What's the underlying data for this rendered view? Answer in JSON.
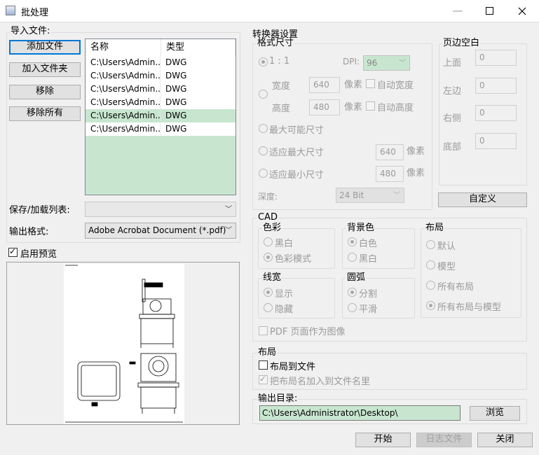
{
  "window": {
    "title": "批处理",
    "min": "—",
    "max": "☐",
    "close": "✕"
  },
  "import": {
    "group_label": "导入文件:",
    "add_file": "添加文件",
    "add_folder": "加入文件夹",
    "remove": "移除",
    "remove_all": "移除所有",
    "columns": [
      "名称",
      "类型"
    ],
    "rows": [
      {
        "name": "C:\\Users\\Admin...",
        "type": "DWG"
      },
      {
        "name": "C:\\Users\\Admin...",
        "type": "DWG"
      },
      {
        "name": "C:\\Users\\Admin...",
        "type": "DWG"
      },
      {
        "name": "C:\\Users\\Admin...",
        "type": "DWG"
      },
      {
        "name": "C:\\Users\\Admin...",
        "type": "DWG"
      },
      {
        "name": "C:\\Users\\Admin...",
        "type": "DWG"
      }
    ],
    "save_load_label": "保存/加载列表:",
    "save_load_value": "",
    "output_format_label": "输出格式:",
    "output_format_value": "Adobe Acrobat Document (*.pdf)",
    "enable_preview": "启用预览"
  },
  "converter": {
    "title": "转换器设置",
    "format_size": {
      "label": "格式尺寸",
      "ratio": "1 : 1",
      "dpi_label": "DPI:",
      "dpi_value": "96",
      "width_label": "宽度",
      "width_value": "640",
      "height_label": "高度",
      "height_value": "480",
      "px": "像素",
      "auto_width": "自动宽度",
      "auto_height": "自动高度",
      "max_size": "最大可能尺寸",
      "fit_max": "适应最大尺寸",
      "fit_max_value": "640",
      "fit_min": "适应最小尺寸",
      "fit_min_value": "480",
      "depth_label": "深度:",
      "depth_value": "24 Bit"
    },
    "margins": {
      "label": "页边空白",
      "top": "上面",
      "top_value": "0",
      "left": "左边",
      "left_value": "0",
      "right": "右侧",
      "right_value": "0",
      "bottom": "底部",
      "bottom_value": "0",
      "custom": "自定义"
    },
    "cad": {
      "label": "CAD",
      "color_label": "色彩",
      "bw": "黑白",
      "color_mode": "色彩模式",
      "bg_label": "背景色",
      "white": "白色",
      "black": "黑白",
      "layout_label": "布局",
      "default": "默认",
      "model": "模型",
      "all_layouts": "所有布局",
      "all_layouts_model": "所有布局与模型",
      "lw_label": "线宽",
      "show": "显示",
      "hide": "隐藏",
      "arc_label": "圆弧",
      "split": "分割",
      "smooth": "平滑",
      "pdf_as_image": "PDF 页面作为图像"
    },
    "layout": {
      "label": "布局",
      "layout_to_file": "布局到文件",
      "add_layout_name": "把布局名加入到文件名里"
    },
    "output": {
      "label": "输出目录:",
      "path": "C:\\Users\\Administrator\\Desktop\\",
      "browse": "浏览"
    }
  },
  "footer": {
    "start": "开始",
    "log": "日志文件",
    "close": "关闭"
  },
  "colors": {
    "list_bg": "#c8e6cf",
    "accent": "#0078d7",
    "input_green": "#c8e6cf"
  }
}
